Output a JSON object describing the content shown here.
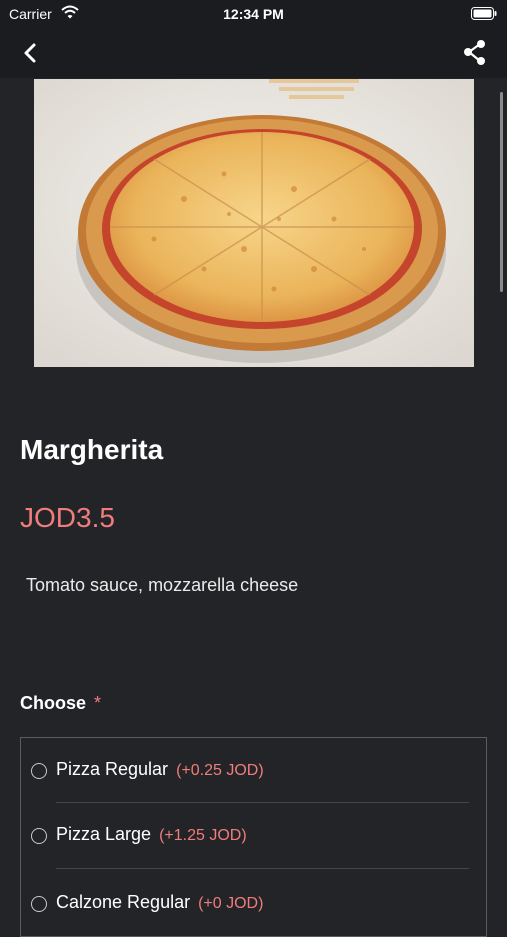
{
  "status_bar": {
    "carrier": "Carrier",
    "time": "12:34 PM"
  },
  "nav": {
    "back_icon": "chevron-left-icon",
    "share_icon": "share-icon"
  },
  "product": {
    "name": "Margherita",
    "price": "JOD3.5",
    "description": "Tomato sauce, mozzarella cheese"
  },
  "choose": {
    "label": "Choose",
    "required_mark": "*",
    "options": [
      {
        "label": "Pizza Regular",
        "price": "(+0.25 JOD)"
      },
      {
        "label": "Pizza Large",
        "price": "(+1.25 JOD)"
      },
      {
        "label": "Calzone Regular",
        "price": "(+0 JOD)"
      }
    ]
  },
  "colors": {
    "background": "#232427",
    "bar": "#1b1c1f",
    "accent": "#f07c7c"
  }
}
